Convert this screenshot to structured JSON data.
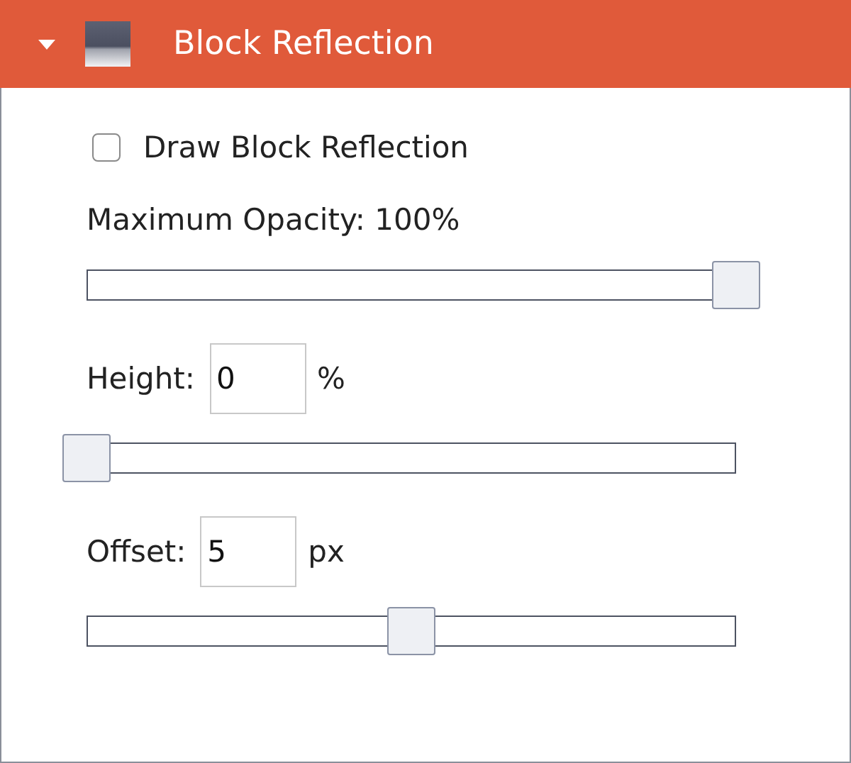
{
  "panel": {
    "title": "Block Reflection",
    "expanded": true
  },
  "checkbox": {
    "label": "Draw Block Reflection",
    "checked": false
  },
  "settings": [
    {
      "kind": "readout",
      "label": "Maximum Opacity: 100%",
      "level": 1
    },
    {
      "kind": "input",
      "label": "Height:",
      "value": "0",
      "unit": "%",
      "level": 0
    },
    {
      "kind": "input",
      "label": "Offset:",
      "value": "5",
      "unit": "px",
      "level": 0.5
    }
  ]
}
